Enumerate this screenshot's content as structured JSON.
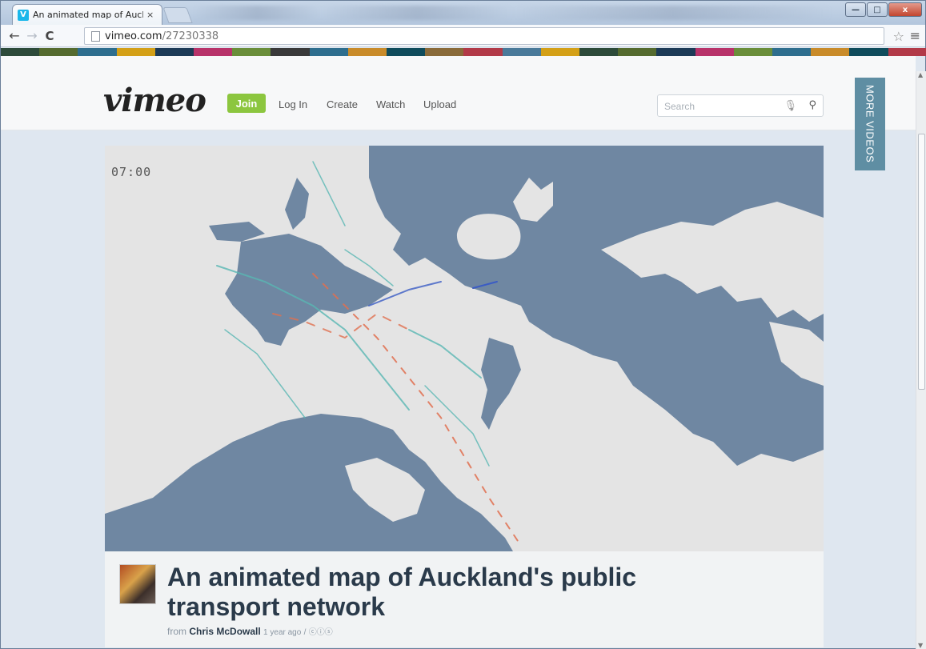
{
  "browser": {
    "tab_title": "An animated map of Auckland's public transport network",
    "tab_favicon": "V",
    "tab_close": "×",
    "url_host": "vimeo.com",
    "url_path": "/27230338",
    "back": "←",
    "forward": "→",
    "reload": "C",
    "star": "☆",
    "menu": "≡",
    "minimize": "—",
    "maximize": "□",
    "close": "x"
  },
  "header": {
    "logo": "vimeo",
    "join_label": "Join",
    "nav": [
      "Log In",
      "Create",
      "Watch",
      "Upload"
    ],
    "search_placeholder": "Search",
    "mic_icon": "microphone-icon",
    "search_icon": "search-icon",
    "more_videos": "MORE VIDEOS"
  },
  "stripe_colors": [
    "#2d4b3a",
    "#556b2f",
    "#2e6e8e",
    "#d4a017",
    "#1d3b57",
    "#b8336a",
    "#6a8e3a",
    "#3a3a3a",
    "#2e6e8e",
    "#c98b2a",
    "#0f4c5c",
    "#8a6b3a",
    "#b23a48",
    "#4a7a9a",
    "#d4a017",
    "#2d4b3a",
    "#556b2f",
    "#1d3b57",
    "#b8336a",
    "#6a8e3a",
    "#2e6e8e",
    "#c98b2a",
    "#0f4c5c",
    "#b23a48"
  ],
  "video": {
    "timestamp": "07:00",
    "land_color": "#e4e4e4",
    "water_color": "#6f87a2"
  },
  "info": {
    "title": "An animated map of Auckland's public transport network",
    "from_label": "from",
    "author": "Chris McDowall",
    "age": "1 year ago",
    "license_sep": "/",
    "license_icons": "ⓒⓘⓢ"
  },
  "scrollbar": {
    "up": "▲",
    "down": "▼"
  }
}
